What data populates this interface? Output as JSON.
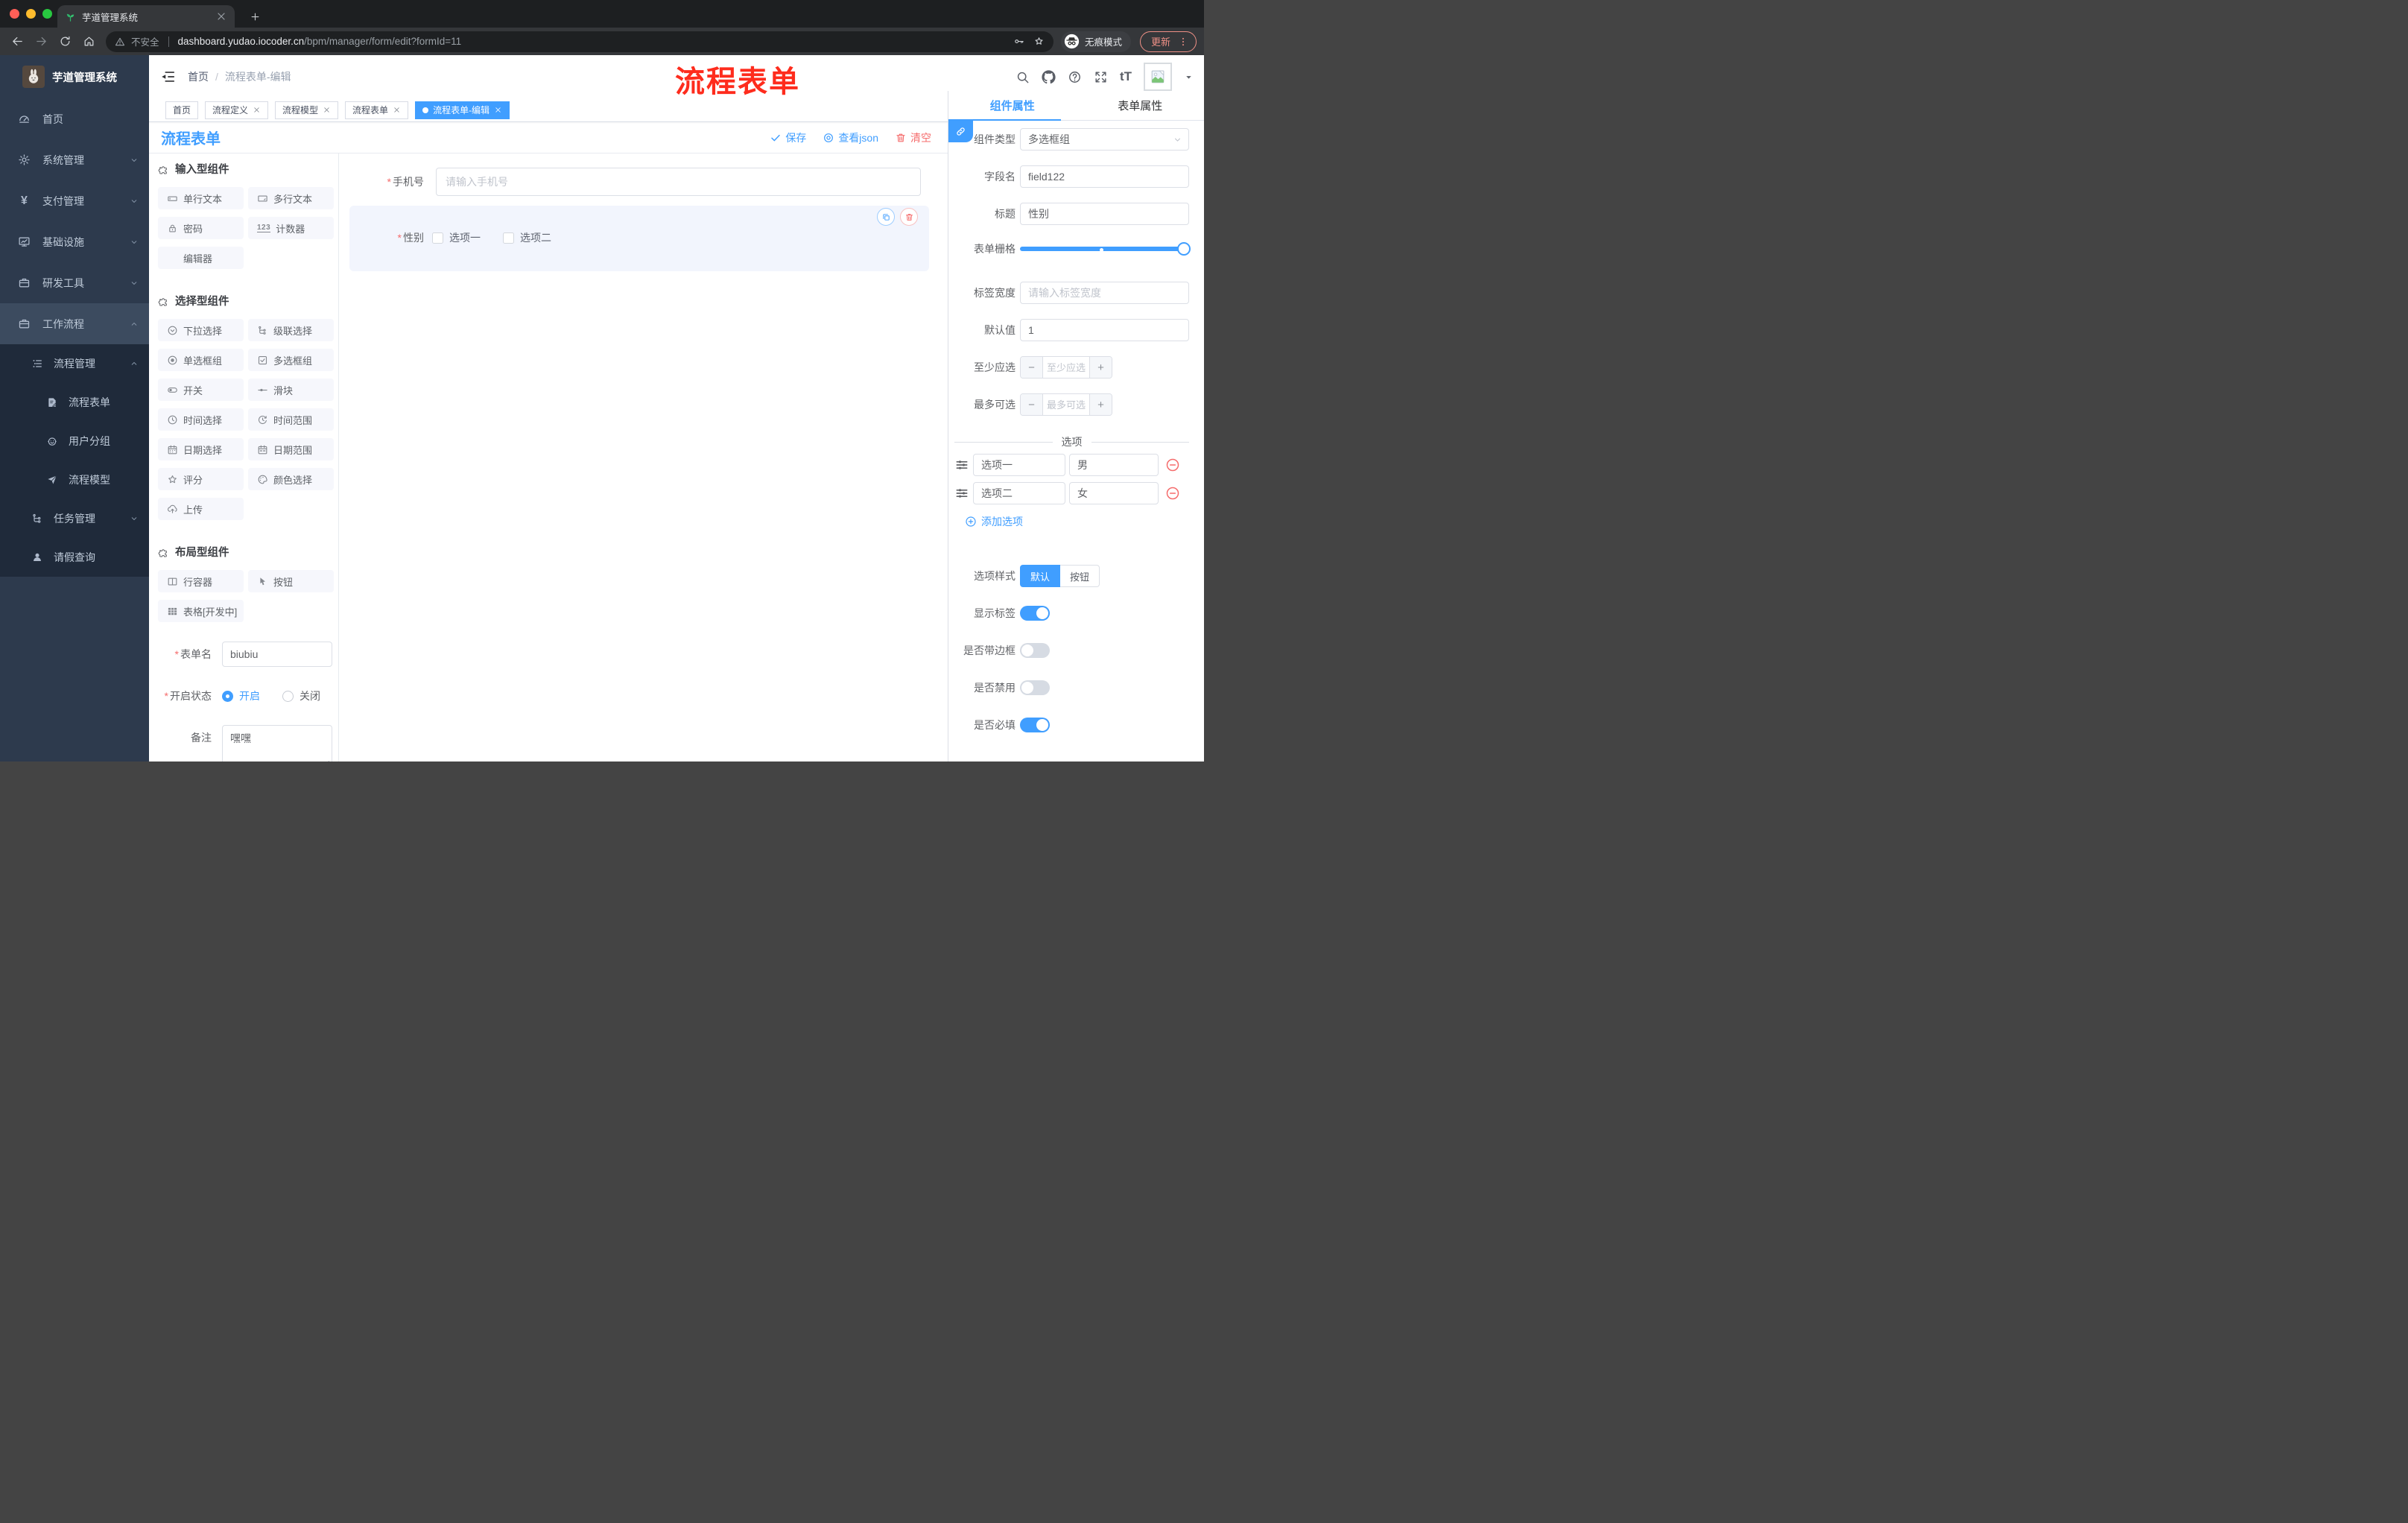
{
  "browser": {
    "tab_title": "芋道管理系统",
    "security": "不安全",
    "url_host": "dashboard.yudao.iocoder.cn",
    "url_path": "/bpm/manager/form/edit?formId=11",
    "incognito": "无痕模式",
    "update": "更新"
  },
  "sidebar": {
    "title": "芋道管理系统",
    "items": [
      {
        "label": "首页",
        "icon": "dashboard-icon"
      },
      {
        "label": "系统管理",
        "icon": "gear-icon"
      },
      {
        "label": "支付管理",
        "icon": "yen-icon"
      },
      {
        "label": "基础设施",
        "icon": "monitor-icon"
      },
      {
        "label": "研发工具",
        "icon": "briefcase-icon"
      },
      {
        "label": "工作流程",
        "icon": "briefcase-icon"
      }
    ],
    "yen_glyph": "¥",
    "submenu": [
      {
        "label": "流程管理",
        "icon": "list-tree-icon"
      },
      {
        "label": "流程表单",
        "icon": "doc-edit-icon"
      },
      {
        "label": "用户分组",
        "icon": "robot-face-icon"
      },
      {
        "label": "流程模型",
        "icon": "paper-plane-icon"
      },
      {
        "label": "任务管理",
        "icon": "tree-icon"
      },
      {
        "label": "请假查询",
        "icon": "user-icon"
      }
    ]
  },
  "navbar": {
    "breadcrumb_home": "首页",
    "breadcrumb_sep": "/",
    "breadcrumb_current": "流程表单-编辑",
    "annotation": "流程表单",
    "fontsize_glyph": "tT"
  },
  "tags": [
    {
      "label": "首页"
    },
    {
      "label": "流程定义"
    },
    {
      "label": "流程模型"
    },
    {
      "label": "流程表单"
    },
    {
      "label": "流程表单-编辑"
    }
  ],
  "content": {
    "title": "流程表单",
    "save": "保存",
    "view_json": "查看json",
    "clear": "清空"
  },
  "panel": {
    "groups": [
      {
        "title": "输入型组件",
        "items": [
          "单行文本",
          "多行文本",
          "密码",
          "计数器",
          "编辑器"
        ]
      },
      {
        "title": "选择型组件",
        "items": [
          "下拉选择",
          "级联选择",
          "单选框组",
          "多选框组",
          "开关",
          "滑块",
          "时间选择",
          "时间范围",
          "日期选择",
          "日期范围",
          "评分",
          "颜色选择",
          "上传"
        ]
      },
      {
        "title": "布局型组件",
        "items": [
          "行容器",
          "按钮",
          "表格[开发中]"
        ]
      }
    ],
    "counter_glyph": "123",
    "form": {
      "name_label": "表单名",
      "name_value": "biubiu",
      "status_label": "开启状态",
      "status_on": "开启",
      "status_off": "关闭",
      "remark_label": "备注",
      "remark_value": "嘿嘿"
    }
  },
  "canvas": {
    "phone_label": "手机号",
    "phone_placeholder": "请输入手机号",
    "gender_label": "性别",
    "gender_option1": "选项一",
    "gender_option2": "选项二"
  },
  "props": {
    "tab_component": "组件属性",
    "tab_form": "表单属性",
    "type_label": "组件类型",
    "type_value": "多选框组",
    "field_label": "字段名",
    "field_value": "field122",
    "title_label": "标题",
    "title_value": "性别",
    "grid_label": "表单栅格",
    "width_label": "标签宽度",
    "width_placeholder": "请输入标签宽度",
    "default_label": "默认值",
    "default_value": "1",
    "min_label": "至少应选",
    "min_placeholder": "至少应选",
    "max_label": "最多可选",
    "max_placeholder": "最多可选",
    "options_title": "选项",
    "options": [
      {
        "label": "选项一",
        "value": "男"
      },
      {
        "label": "选项二",
        "value": "女"
      }
    ],
    "add_option": "添加选项",
    "style_label": "选项样式",
    "style_default": "默认",
    "style_button": "按钮",
    "switch_show_label": "显示标签",
    "switch_border": "是否带边框",
    "switch_disabled": "是否禁用",
    "switch_required": "是否必填"
  },
  "colors": {
    "accent": "#409eff",
    "danger": "#f56c6c",
    "annotation_red": "#fe2c1d",
    "sidebar_bg": "#2d3a4d"
  }
}
